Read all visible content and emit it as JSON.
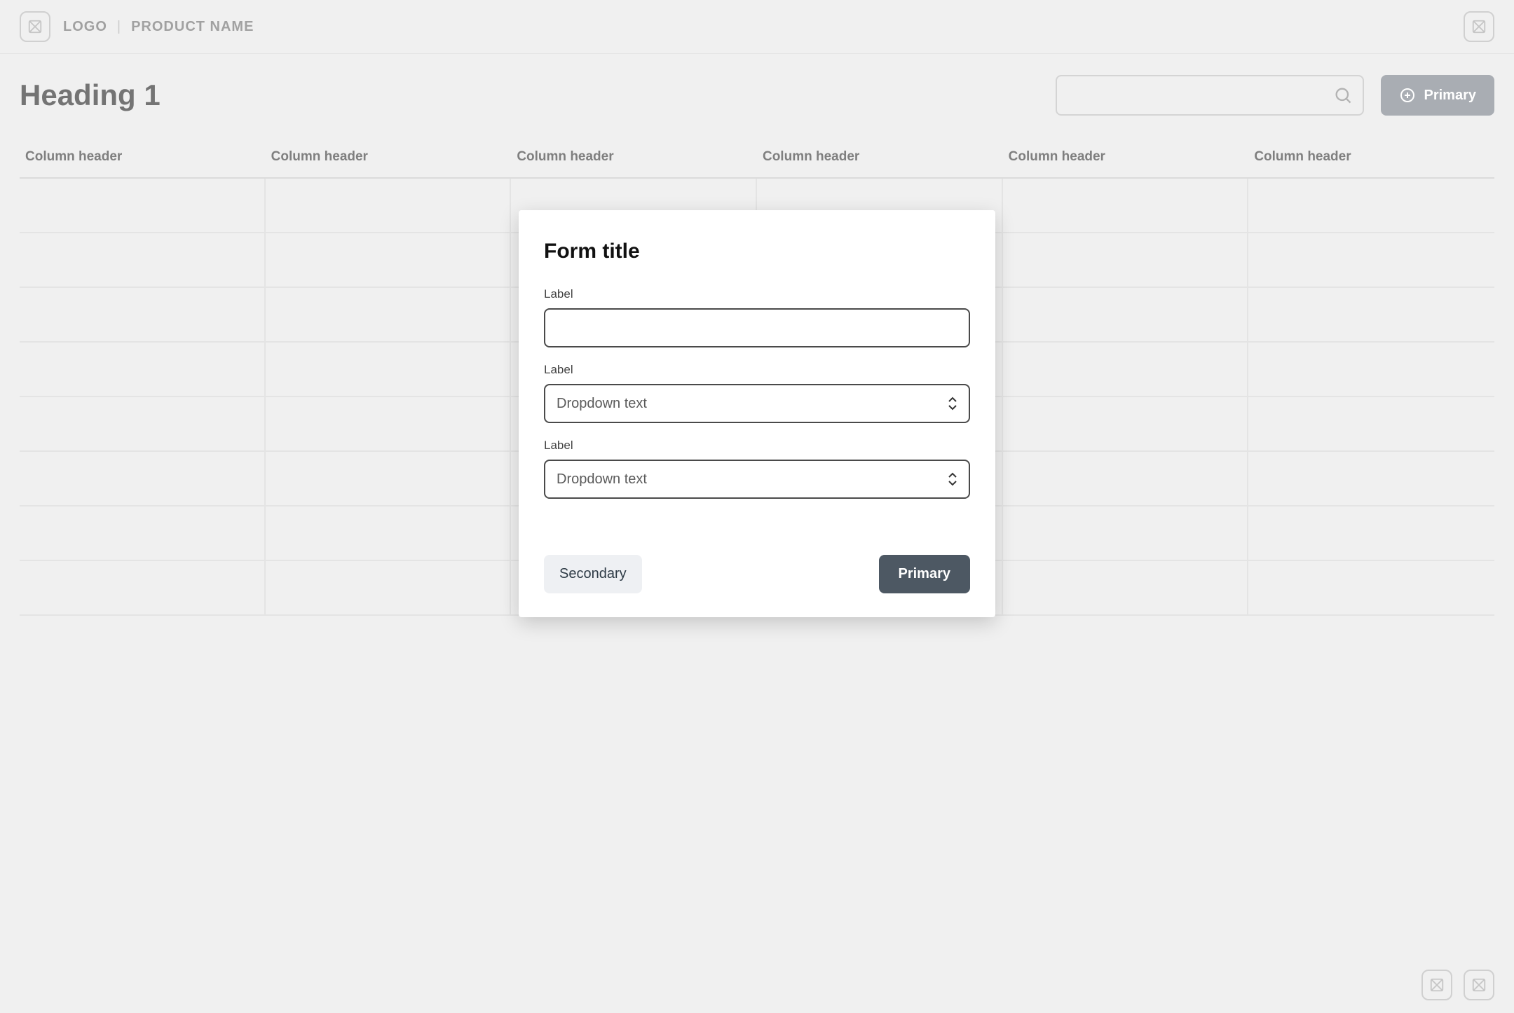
{
  "header": {
    "logo_text": "LOGO",
    "separator": "|",
    "product_name": "PRODUCT NAME"
  },
  "page": {
    "heading": "Heading 1",
    "search_placeholder": "",
    "primary_button": "Primary"
  },
  "table": {
    "columns": [
      "Column header",
      "Column header",
      "Column header",
      "Column header",
      "Column header",
      "Column header"
    ],
    "row_count": 8
  },
  "modal": {
    "title": "Form title",
    "fields": [
      {
        "label": "Label",
        "type": "text",
        "value": ""
      },
      {
        "label": "Label",
        "type": "select",
        "value": "Dropdown text"
      },
      {
        "label": "Label",
        "type": "select",
        "value": "Dropdown text"
      }
    ],
    "secondary_button": "Secondary",
    "primary_button": "Primary"
  }
}
